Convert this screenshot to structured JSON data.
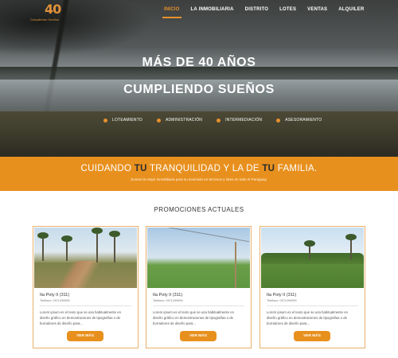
{
  "logo": {
    "number": "40",
    "tagline": "Cumpliendo Sueños"
  },
  "nav": {
    "items": [
      {
        "label": "INICIO",
        "active": true
      },
      {
        "label": "LA INMOBILIARIA",
        "active": false
      },
      {
        "label": "DISTRITO",
        "active": false
      },
      {
        "label": "LOTES",
        "active": false
      },
      {
        "label": "VENTAS",
        "active": false
      },
      {
        "label": "ALQUILER",
        "active": false
      }
    ]
  },
  "hero": {
    "title_line1": "MÁS DE 40 AÑOS",
    "title_line2": "CUMPLIENDO SUEÑOS",
    "features": [
      "LOTEAMIENTO",
      "ADMINISTRACIÓN",
      "INTERMEDIACIÓN",
      "ASESORAMIENTO"
    ]
  },
  "band": {
    "title_part1": "CUIDANDO ",
    "title_highlight1": "TU",
    "title_part2": " TRANQUILIDAD Y LA DE ",
    "title_highlight2": "TU",
    "title_part3": " FAMILIA.",
    "subtitle": "Somos la mejor inmobiliaria para su inversión en terrenos y lotes en todo el Paraguay.",
    "accent_color": "#e8901e"
  },
  "promotions": {
    "heading": "PROMOCIONES ACTUALES",
    "cards": [
      {
        "title": "Ita Poty II (311)",
        "phone": "Teléfono: 0971299999",
        "description": "Lorem ipsum es el texto que se usa habitualmente en diseño gráfico en demostraciones de tipografías o de borradores de diseño para...",
        "button": "VER MÁS"
      },
      {
        "title": "Ita Poty II (311)",
        "phone": "Teléfono: 0971299999",
        "description": "Lorem ipsum es el texto que se usa habitualmente en diseño gráfico en demostraciones de tipografías o de borradores de diseño para...",
        "button": "VER MÁS"
      },
      {
        "title": "Ita Poty II (311)",
        "phone": "Teléfono: 0971299999",
        "description": "Lorem ipsum es el texto que se usa habitualmente en diseño gráfico en demostraciones de tipografías o de borradores de diseño para...",
        "button": "VER MÁS"
      }
    ]
  }
}
